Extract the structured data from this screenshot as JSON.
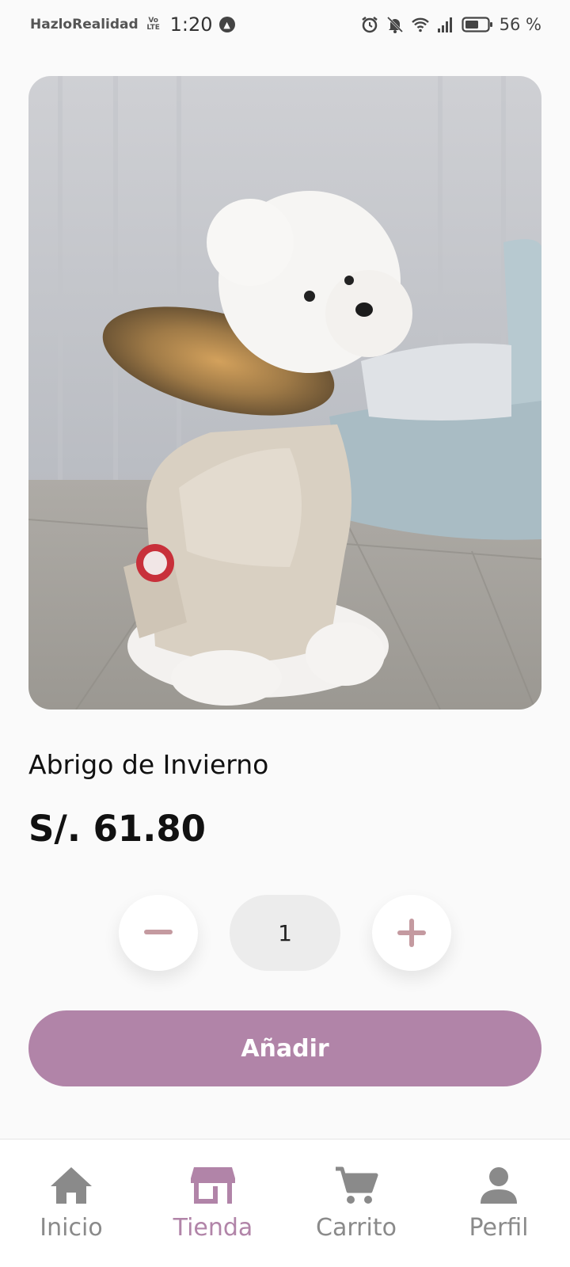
{
  "status_bar": {
    "carrier": "HazloRealidad",
    "network_badge": "Vo LTE",
    "time": "1:20",
    "battery_percent": "56 %",
    "icons": [
      "app-notification-icon",
      "alarm-icon",
      "bell-muted-icon",
      "wifi-icon",
      "signal-icon",
      "battery-icon"
    ]
  },
  "product": {
    "image_description_icon": "product-photo",
    "name": "Abrigo de Invierno",
    "price": "S/. 61.80"
  },
  "quantity": {
    "value": "1",
    "minus_icon": "minus-icon",
    "plus_icon": "plus-icon"
  },
  "add_button": {
    "label": "Añadir"
  },
  "nav": {
    "items": [
      {
        "label": "Inicio",
        "icon": "home-icon",
        "active": false
      },
      {
        "label": "Tienda",
        "icon": "store-icon",
        "active": true
      },
      {
        "label": "Carrito",
        "icon": "cart-icon",
        "active": false
      },
      {
        "label": "Perfil",
        "icon": "user-icon",
        "active": false
      }
    ]
  },
  "colors": {
    "accent": "#b184a8",
    "background": "#fafafa",
    "inactive": "#8a8a8a",
    "qty_minus_plus": "#c49aa0"
  }
}
